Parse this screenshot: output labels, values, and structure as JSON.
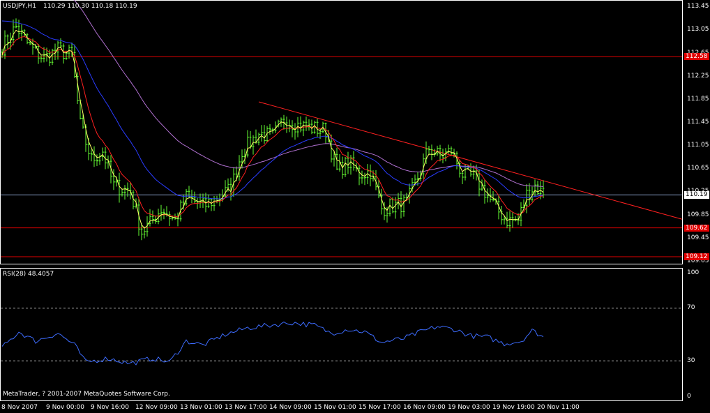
{
  "header": {
    "symbol_label": "USDJPY,H1",
    "ohlc_label": "110.29 110.30 110.18 110.19"
  },
  "rsi": {
    "label": "RSI(28)",
    "value": "48.4057",
    "color": "#3d6cff"
  },
  "copyright": "MetaTrader, ? 2001-2007 MetaQuotes Software Corp.",
  "price_axis": {
    "ticks": [
      "113.45",
      "113.05",
      "112.65",
      "112.25",
      "111.85",
      "111.45",
      "111.05",
      "110.65",
      "110.25",
      "109.85",
      "109.45",
      "109.05"
    ],
    "levels": [
      {
        "label": "112.58",
        "value": 112.58
      },
      {
        "label": "109.62",
        "value": 109.62
      },
      {
        "label": "109.12",
        "value": 109.12
      }
    ],
    "current": {
      "label": "110.19",
      "value": 110.19
    }
  },
  "rsi_axis": {
    "ticks": [
      "100",
      "70",
      "30",
      "0"
    ],
    "overbought": 70,
    "oversold": 30
  },
  "time_axis": [
    "8 Nov 2007",
    "9 Nov 00:00",
    "9 Nov 16:00",
    "12 Nov 09:00",
    "13 Nov 01:00",
    "13 Nov 17:00",
    "14 Nov 09:00",
    "15 Nov 01:00",
    "15 Nov 17:00",
    "16 Nov 09:00",
    "19 Nov 03:00",
    "19 Nov 19:00",
    "20 Nov 11:00"
  ],
  "colors": {
    "background": "#000000",
    "bars": "#66ff33",
    "ma_fast": "#ffff66",
    "ma_mid": "#ff2020",
    "ma_slow": "#2a3cff",
    "ma_slowest": "#b070d0",
    "level_line": "#e00000",
    "trendline": "#ff2020",
    "current_price_line": "#8aa0c8",
    "rsi_line": "#3d6cff"
  },
  "chart_data": {
    "type": "candlestick",
    "symbol": "USDJPY",
    "timeframe": "H1",
    "ylim": [
      109.0,
      113.55
    ],
    "levels": [
      112.58,
      109.62,
      109.12
    ],
    "current_price": 110.19,
    "trendline": {
      "from": {
        "bar": 92,
        "price": 111.8
      },
      "to": {
        "bar": 234,
        "price": 109.9
      }
    },
    "close_keypoints": [
      {
        "bar": 0,
        "price": 112.75
      },
      {
        "bar": 5,
        "price": 113.1
      },
      {
        "bar": 10,
        "price": 112.75
      },
      {
        "bar": 15,
        "price": 112.55
      },
      {
        "bar": 20,
        "price": 112.7
      },
      {
        "bar": 25,
        "price": 112.6
      },
      {
        "bar": 28,
        "price": 111.4
      },
      {
        "bar": 32,
        "price": 110.8
      },
      {
        "bar": 36,
        "price": 110.95
      },
      {
        "bar": 40,
        "price": 110.35
      },
      {
        "bar": 46,
        "price": 110.25
      },
      {
        "bar": 50,
        "price": 109.55
      },
      {
        "bar": 53,
        "price": 109.7
      },
      {
        "bar": 57,
        "price": 109.95
      },
      {
        "bar": 62,
        "price": 109.75
      },
      {
        "bar": 66,
        "price": 110.15
      },
      {
        "bar": 72,
        "price": 110.0
      },
      {
        "bar": 76,
        "price": 110.1
      },
      {
        "bar": 82,
        "price": 110.3
      },
      {
        "bar": 86,
        "price": 110.95
      },
      {
        "bar": 92,
        "price": 111.25
      },
      {
        "bar": 97,
        "price": 111.2
      },
      {
        "bar": 101,
        "price": 111.5
      },
      {
        "bar": 106,
        "price": 111.4
      },
      {
        "bar": 111,
        "price": 111.35
      },
      {
        "bar": 116,
        "price": 111.3
      },
      {
        "bar": 120,
        "price": 110.6
      },
      {
        "bar": 124,
        "price": 110.75
      },
      {
        "bar": 128,
        "price": 110.55
      },
      {
        "bar": 132,
        "price": 110.6
      },
      {
        "bar": 136,
        "price": 109.95
      },
      {
        "bar": 140,
        "price": 110.0
      },
      {
        "bar": 145,
        "price": 110.05
      },
      {
        "bar": 149,
        "price": 110.5
      },
      {
        "bar": 153,
        "price": 111.0
      },
      {
        "bar": 157,
        "price": 110.85
      },
      {
        "bar": 161,
        "price": 110.95
      },
      {
        "bar": 165,
        "price": 110.55
      },
      {
        "bar": 169,
        "price": 110.5
      },
      {
        "bar": 173,
        "price": 110.25
      },
      {
        "bar": 177,
        "price": 109.95
      },
      {
        "bar": 181,
        "price": 109.75
      },
      {
        "bar": 185,
        "price": 109.75
      },
      {
        "bar": 188,
        "price": 110.2
      },
      {
        "bar": 191,
        "price": 110.35
      },
      {
        "bar": 194,
        "price": 110.19
      }
    ],
    "rsi_keypoints": [
      {
        "bar": 0,
        "value": 40
      },
      {
        "bar": 6,
        "value": 52
      },
      {
        "bar": 12,
        "value": 45
      },
      {
        "bar": 20,
        "value": 51
      },
      {
        "bar": 26,
        "value": 42
      },
      {
        "bar": 30,
        "value": 29
      },
      {
        "bar": 38,
        "value": 32
      },
      {
        "bar": 46,
        "value": 28
      },
      {
        "bar": 54,
        "value": 32
      },
      {
        "bar": 60,
        "value": 29
      },
      {
        "bar": 66,
        "value": 45
      },
      {
        "bar": 72,
        "value": 42
      },
      {
        "bar": 80,
        "value": 50
      },
      {
        "bar": 88,
        "value": 55
      },
      {
        "bar": 96,
        "value": 57
      },
      {
        "bar": 104,
        "value": 59
      },
      {
        "bar": 112,
        "value": 57
      },
      {
        "bar": 118,
        "value": 51
      },
      {
        "bar": 124,
        "value": 54
      },
      {
        "bar": 130,
        "value": 52
      },
      {
        "bar": 136,
        "value": 44
      },
      {
        "bar": 144,
        "value": 47
      },
      {
        "bar": 150,
        "value": 52
      },
      {
        "bar": 156,
        "value": 56
      },
      {
        "bar": 162,
        "value": 54
      },
      {
        "bar": 168,
        "value": 49
      },
      {
        "bar": 174,
        "value": 48
      },
      {
        "bar": 180,
        "value": 43
      },
      {
        "bar": 186,
        "value": 45
      },
      {
        "bar": 190,
        "value": 53
      },
      {
        "bar": 194,
        "value": 48.4
      }
    ],
    "rsi_ylim": [
      0,
      100
    ]
  }
}
